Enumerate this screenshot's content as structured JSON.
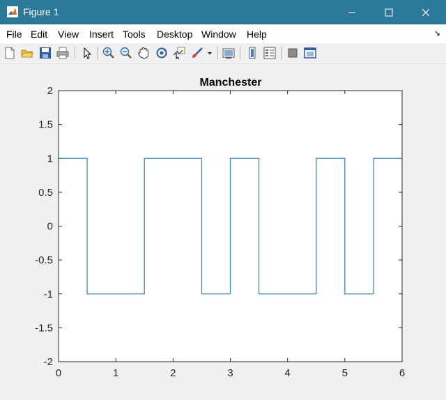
{
  "window": {
    "title": "Figure 1",
    "accent": "#2b7a99"
  },
  "menu": [
    "File",
    "Edit",
    "View",
    "Insert",
    "Tools",
    "Desktop",
    "Window",
    "Help"
  ],
  "toolbar_icons": [
    "new-figure-icon",
    "open-file-icon",
    "save-icon",
    "print-icon",
    "pointer-icon",
    "zoom-in-icon",
    "zoom-out-icon",
    "pan-hand-icon",
    "rotate-3d-icon",
    "data-cursor-icon",
    "brush-icon",
    "link-plot-icon",
    "colorbar-icon",
    "legend-icon",
    "hide-plot-tools-icon",
    "show-plot-tools-icon"
  ],
  "chart_data": {
    "type": "line",
    "title": "Manchester",
    "xlabel": "",
    "ylabel": "",
    "xlim": [
      0,
      6
    ],
    "ylim": [
      -2,
      2
    ],
    "xticks": [
      0,
      1,
      2,
      3,
      4,
      5,
      6
    ],
    "yticks": [
      2,
      1.5,
      1,
      0.5,
      0,
      -0.5,
      -1,
      -1.5,
      -2
    ],
    "xtick_labels": [
      "0",
      "1",
      "2",
      "3",
      "4",
      "5",
      "6"
    ],
    "ytick_labels": [
      "2",
      "1.5",
      "1",
      "0.5",
      "0",
      "-0.5",
      "-1",
      "-1.5",
      "-2"
    ],
    "grid": false,
    "series": [
      {
        "color": "#3b8bc5",
        "x": [
          0,
          0.5,
          0.5,
          1.5,
          1.5,
          2.5,
          2.5,
          3,
          3,
          3.5,
          3.5,
          4.5,
          4.5,
          5,
          5,
          5.5,
          5.5,
          6
        ],
        "y": [
          1,
          1,
          -1,
          -1,
          1,
          1,
          -1,
          -1,
          1,
          1,
          -1,
          -1,
          1,
          1,
          -1,
          -1,
          1,
          1
        ]
      }
    ]
  }
}
